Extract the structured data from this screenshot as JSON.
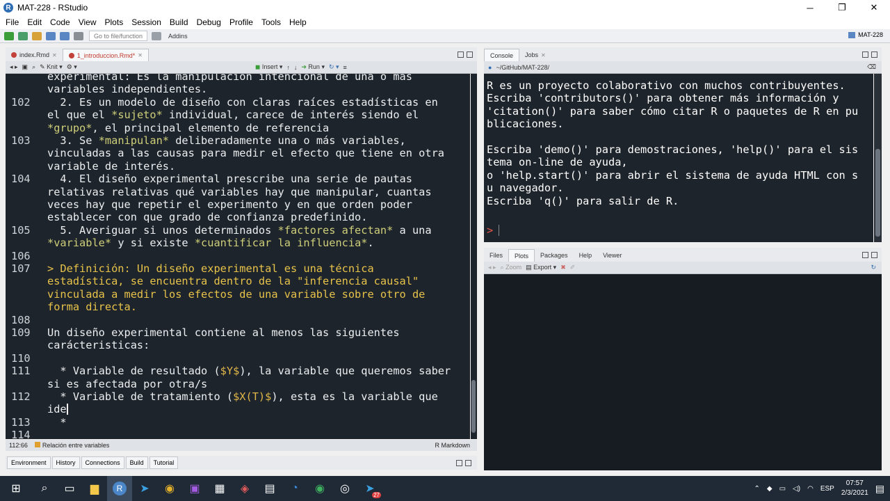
{
  "window": {
    "title": "MAT-228 - RStudio",
    "minimize": "─",
    "maximize": "❐",
    "close": "✕"
  },
  "menu": [
    "File",
    "Edit",
    "Code",
    "View",
    "Plots",
    "Session",
    "Build",
    "Debug",
    "Profile",
    "Tools",
    "Help"
  ],
  "toolbar": {
    "goto_placeholder": "Go to file/function",
    "addins": "Addins",
    "project": "MAT-228"
  },
  "editor": {
    "tabs": [
      {
        "label": "index.Rmd"
      },
      {
        "label": "1_introduccion.Rmd*"
      }
    ],
    "toolbar": {
      "knit": "Knit",
      "insert": "Insert",
      "run": "Run"
    },
    "lines": [
      {
        "num": "",
        "text": "experimental: Es la manipulación intencional de una o más"
      },
      {
        "num": "",
        "text": "variables independientes."
      },
      {
        "num": "102",
        "text": "  2. Es un modelo de diseño con claras raíces estadísticas en"
      },
      {
        "num": "",
        "text": "el que el *sujeto* individual, carece de interés siendo el"
      },
      {
        "num": "",
        "text": "*grupo*, el principal elemento de referencia"
      },
      {
        "num": "103",
        "text": "  3. Se *manipulan* deliberadamente una o más variables,"
      },
      {
        "num": "",
        "text": "vinculadas a las causas para medir el efecto que tiene en otra"
      },
      {
        "num": "",
        "text": "variable de interés."
      },
      {
        "num": "104",
        "text": "  4. El diseño experimental prescribe una serie de pautas"
      },
      {
        "num": "",
        "text": "relativas relativas qué variables hay que manipular, cuantas"
      },
      {
        "num": "",
        "text": "veces hay que repetir el experimento y en que orden poder"
      },
      {
        "num": "",
        "text": "establecer con que grado de confianza predefinido."
      },
      {
        "num": "105",
        "text": "  5. Averiguar si unos determinados *factores afectan* a una"
      },
      {
        "num": "",
        "text": "*variable* y si existe *cuantificar la influencia*."
      },
      {
        "num": "106",
        "text": ""
      },
      {
        "num": "107",
        "text": "> Definición: Un diseño experimental es una técnica"
      },
      {
        "num": "",
        "text": "estadística, se encuentra dentro de la \"inferencia causal\""
      },
      {
        "num": "",
        "text": "vinculada a medir los efectos de una variable sobre otro de"
      },
      {
        "num": "",
        "text": "forma directa."
      },
      {
        "num": "108",
        "text": ""
      },
      {
        "num": "109",
        "text": "Un diseño experimental contiene al menos las siguientes"
      },
      {
        "num": "",
        "text": "carácteristicas:"
      },
      {
        "num": "110",
        "text": ""
      },
      {
        "num": "111",
        "text": "  * Variable de resultado ($Y$), la variable que queremos saber"
      },
      {
        "num": "",
        "text": "si es afectada por otra/s"
      },
      {
        "num": "112",
        "text": "  * Variable de tratamiento ($X(T)$), esta es la variable que"
      },
      {
        "num": "",
        "text": "ide"
      },
      {
        "num": "113",
        "text": "  *"
      },
      {
        "num": "114",
        "text": ""
      }
    ],
    "status": {
      "position": "112:66",
      "section": "Relación entre variables",
      "mode": "R Markdown"
    }
  },
  "console": {
    "tabs": [
      {
        "label": "Console"
      },
      {
        "label": "Jobs"
      }
    ],
    "path": "~/GitHub/MAT-228/",
    "output": "R es un proyecto colaborativo con muchos contribuyentes.\nEscriba 'contributors()' para obtener más información y\n'citation()' para saber cómo citar R o paquetes de R en pu\nblicaciones.\n\nEscriba 'demo()' para demostraciones, 'help()' para el sis\ntema on-line de ayuda,\no 'help.start()' para abrir el sistema de ayuda HTML con s\nu navegador.\nEscriba 'q()' para salir de R.\n",
    "prompt": ">"
  },
  "viewer": {
    "tabs": [
      {
        "label": "Files"
      },
      {
        "label": "Plots"
      },
      {
        "label": "Packages"
      },
      {
        "label": "Help"
      },
      {
        "label": "Viewer"
      }
    ],
    "zoom": "Zoom",
    "export": "Export"
  },
  "bottom_tabs": [
    "Environment",
    "History",
    "Connections",
    "Build",
    "Tutorial"
  ],
  "taskbar": {
    "lang": "ESP",
    "time": "07:57",
    "date": "2/3/2021",
    "badge": "27"
  }
}
